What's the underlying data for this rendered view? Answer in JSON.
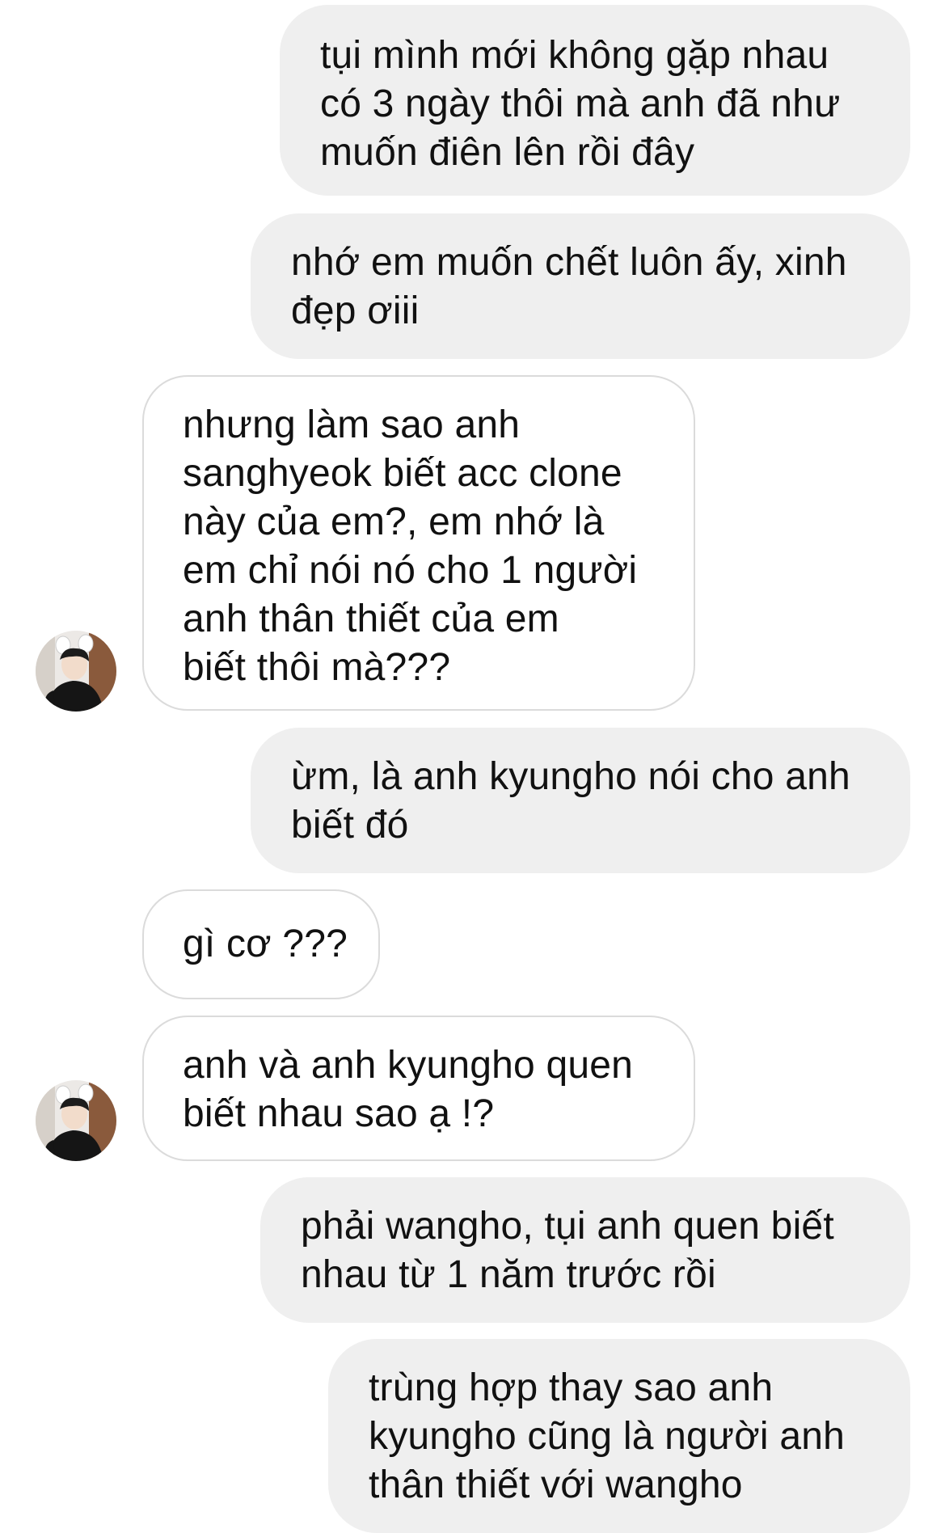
{
  "messages": [
    {
      "direction": "outgoing",
      "text": "tụi mình mới không gặp nhau\ncó 3 ngày thôi mà anh đã như\nmuốn điên lên rồi đây"
    },
    {
      "direction": "outgoing",
      "text": "nhớ em muốn chết luôn ấy, xinh\nđẹp ơiii"
    },
    {
      "direction": "incoming",
      "text": "nhưng làm sao anh\nsanghyeok biết acc clone\nnày của em?, em nhớ là\nem chỉ nói nó cho 1 người\nanh thân thiết của em\nbiết thôi mà???"
    },
    {
      "direction": "outgoing",
      "text": "ừm, là anh kyungho nói cho anh\nbiết đó"
    },
    {
      "direction": "incoming",
      "text": "gì cơ ???"
    },
    {
      "direction": "incoming",
      "text": "anh và anh kyungho quen\nbiết nhau sao ạ !?"
    },
    {
      "direction": "outgoing",
      "text": "phải wangho, tụi anh quen biết\nnhau từ 1 năm trước rồi"
    },
    {
      "direction": "outgoing",
      "text": "trùng hợp thay sao anh\nkyungho cũng là người anh\nthân thiết với wangho"
    }
  ],
  "colors": {
    "outgoing_bubble": "#efefef",
    "incoming_border": "#dbdbdb",
    "text": "#111111"
  },
  "icons": {
    "avatar": "contact-avatar-photo"
  }
}
